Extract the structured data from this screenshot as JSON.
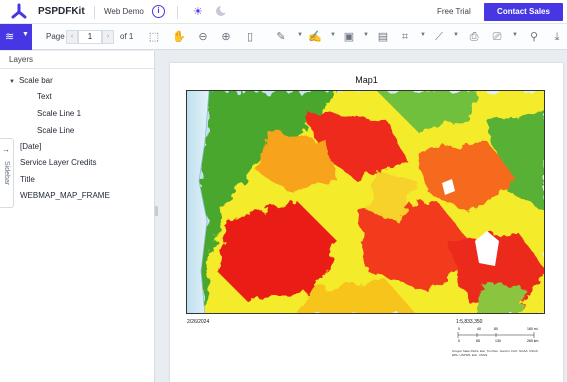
{
  "app": {
    "brand": "PSPDFKit",
    "web_demo": "Web Demo",
    "free_trial": "Free Trial",
    "contact_sales": "Contact Sales",
    "accent_color": "#4636e3"
  },
  "toolbar": {
    "page_label": "Page",
    "current_page": "1",
    "of_label": "of 1",
    "icons": [
      "layers-icon",
      "pan-icon",
      "zoom-out-icon",
      "zoom-in-icon",
      "fit-page-icon",
      "pen-icon",
      "signature-icon",
      "image-icon",
      "note-icon",
      "crop-icon",
      "line-icon",
      "print-icon",
      "stamp-icon",
      "search-icon",
      "download-icon"
    ]
  },
  "sidebar": {
    "title": "Layers",
    "tab_label": "Sidebar",
    "items": [
      {
        "label": "Scale bar",
        "expanded": true
      },
      {
        "label": "Text"
      },
      {
        "label": "Scale Line 1"
      },
      {
        "label": "Scale Line"
      },
      {
        "label": "[Date]"
      },
      {
        "label": "Service Layer Credits"
      },
      {
        "label": "Title"
      },
      {
        "label": "WEBMAP_MAP_FRAME"
      }
    ]
  },
  "document": {
    "map_title": "Map1",
    "date": "2/26/2024",
    "scale": "1:5,833,350",
    "scale_top_ticks": [
      "0",
      "40",
      "80",
      "160 mi"
    ],
    "scale_bottom_ticks": [
      "0",
      "65",
      "130",
      "260 km"
    ],
    "credits": "Oregon State Parks, Esri, TomTom, Garmin, FAO, NOAA, USGS, EPA, USFWS, Esri, USGS"
  }
}
